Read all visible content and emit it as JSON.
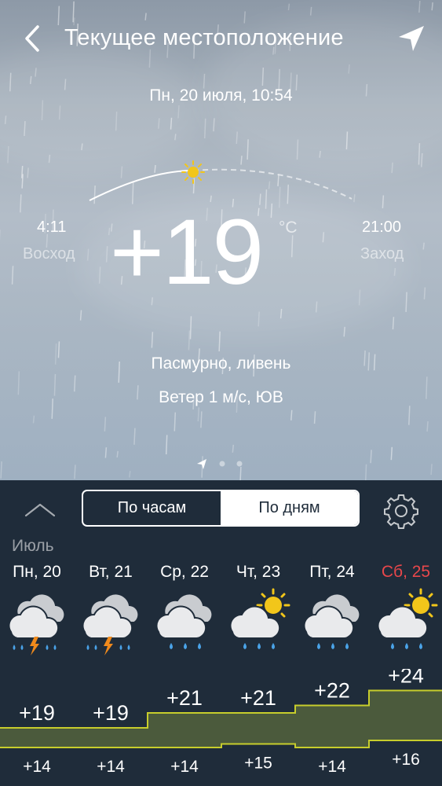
{
  "header": {
    "title": "Текущее местоположение",
    "back_icon": "chevron-left-icon",
    "locate_icon": "location-arrow-icon"
  },
  "current": {
    "datetime": "Пн, 20 июля, 10:54",
    "temperature": "+19",
    "unit": "°C",
    "condition": "Пасмурно, ливень",
    "wind": "Ветер 1 м/с, ЮВ",
    "sunrise": {
      "time": "4:11",
      "label": "Восход"
    },
    "sunset": {
      "time": "21:00",
      "label": "Заход"
    },
    "sun_progress": 0.42
  },
  "pager": {
    "count": 3,
    "active": 0
  },
  "forecast_panel": {
    "tabs": [
      {
        "label": "По часам",
        "active": true
      },
      {
        "label": "По дням",
        "active": false
      }
    ],
    "month": "Июль",
    "days": [
      {
        "label": "Пн, 20",
        "icon": "cloud-thunder-rain-icon",
        "high": "+19",
        "low": "+14",
        "weekend": false
      },
      {
        "label": "Вт, 21",
        "icon": "cloud-thunder-rain-icon",
        "high": "+19",
        "low": "+14",
        "weekend": false
      },
      {
        "label": "Ср, 22",
        "icon": "cloud-rain-icon",
        "high": "+21",
        "low": "+14",
        "weekend": false
      },
      {
        "label": "Чт, 23",
        "icon": "sun-cloud-rain-icon",
        "high": "+21",
        "low": "+15",
        "weekend": false
      },
      {
        "label": "Пт, 24",
        "icon": "cloud-rain-icon",
        "high": "+22",
        "low": "+14",
        "weekend": false
      },
      {
        "label": "Сб, 25",
        "icon": "sun-cloud-rain-icon",
        "high": "+24",
        "low": "+16",
        "weekend": true
      }
    ]
  },
  "colors": {
    "panel_bg": "#1f2c3a",
    "weekend": "#e8474b",
    "chart_line": "#c7cd2c",
    "chart_fill": "#4b5a3c",
    "sun": "#f2c61a",
    "bolt": "#f08a1c",
    "raindrop": "#4aa3e8"
  }
}
